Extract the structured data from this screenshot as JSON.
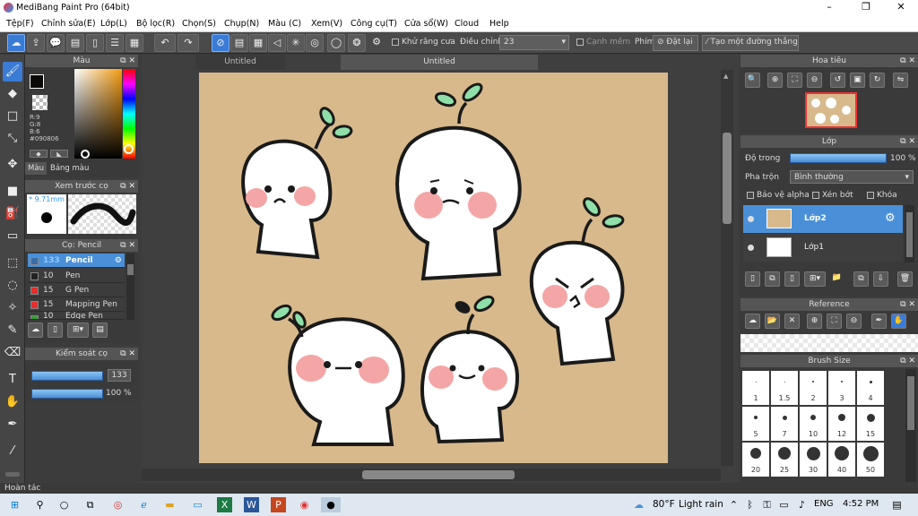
{
  "window": {
    "title": "MediBang Paint Pro (64bit)",
    "minimize": "–",
    "maximize": "❐",
    "close": "✕"
  },
  "menu": [
    "Tệp(F)",
    "Chỉnh sửa(E)",
    "Lớp(L)",
    "Bộ lọc(R)",
    "Chọn(S)",
    "Chụp(N)",
    "Màu (C)",
    "Xem(V)",
    "Công cụ(T)",
    "Cửa sổ(W)",
    "Cloud",
    "Help"
  ],
  "toolbar": {
    "antialias_label": "Khử răng cưa",
    "adjust_label": "Điều chỉnh",
    "adjust_value": "23",
    "soft_edge_label": "Cạnh mềm",
    "key_label": "Phím",
    "reset_label": "Đặt lại",
    "straight_line_label": "Tạo một đường thẳng"
  },
  "color_panel": {
    "title": "Màu",
    "r": "R:9",
    "g": "G:8",
    "b": "B:6",
    "hex": "#090806",
    "tab_color": "Màu",
    "tab_palette": "Bảng màu",
    "primary_color": "#090806",
    "secondary_color": "#ffffff"
  },
  "brush_preview": {
    "title": "Xem trước cọ",
    "size": "9.71mm"
  },
  "brush_list": {
    "title": "Cọ: Pencil",
    "items": [
      {
        "size": "133",
        "name": "Pencil",
        "color": "#ffffff"
      },
      {
        "size": "10",
        "name": "Pen",
        "color": "#222222"
      },
      {
        "size": "15",
        "name": "G Pen",
        "color": "#e03030"
      },
      {
        "size": "15",
        "name": "Mapping Pen",
        "color": "#e03030"
      },
      {
        "size": "10",
        "name": "Edge Pen",
        "color": "#30a030"
      }
    ]
  },
  "brush_control": {
    "title": "Kiểm soát cọ",
    "size_value": "133",
    "opacity_value": "100 %",
    "size_fraction": 1.0,
    "opacity_fraction": 1.0
  },
  "canvas": {
    "tab1": "Untitled",
    "tab2": "Untitled",
    "background": "#d7b98c"
  },
  "navigator": {
    "title": "Hoa tiêu"
  },
  "layer_panel": {
    "title": "Lớp",
    "opacity_label": "Độ trong",
    "opacity_value": "100 %",
    "blend_label": "Pha trộn",
    "blend_value": "Bình thường",
    "protect_alpha": "Bảo vệ alpha",
    "clipping": "Xén bớt",
    "lock": "Khóa",
    "layers": [
      {
        "name": "Lớp2"
      },
      {
        "name": "Lớp1"
      }
    ]
  },
  "reference": {
    "title": "Reference"
  },
  "brush_size": {
    "title": "Brush Size",
    "sizes": [
      "1",
      "1.5",
      "2",
      "3",
      "4",
      "5",
      "7",
      "10",
      "12",
      "15",
      "20",
      "25",
      "30",
      "40",
      "50"
    ]
  },
  "status": {
    "undo": "Hoàn tác"
  },
  "taskbar": {
    "weather_temp": "80°F",
    "weather_text": "Light rain",
    "language": "ENG",
    "time": "4:52 PM"
  }
}
